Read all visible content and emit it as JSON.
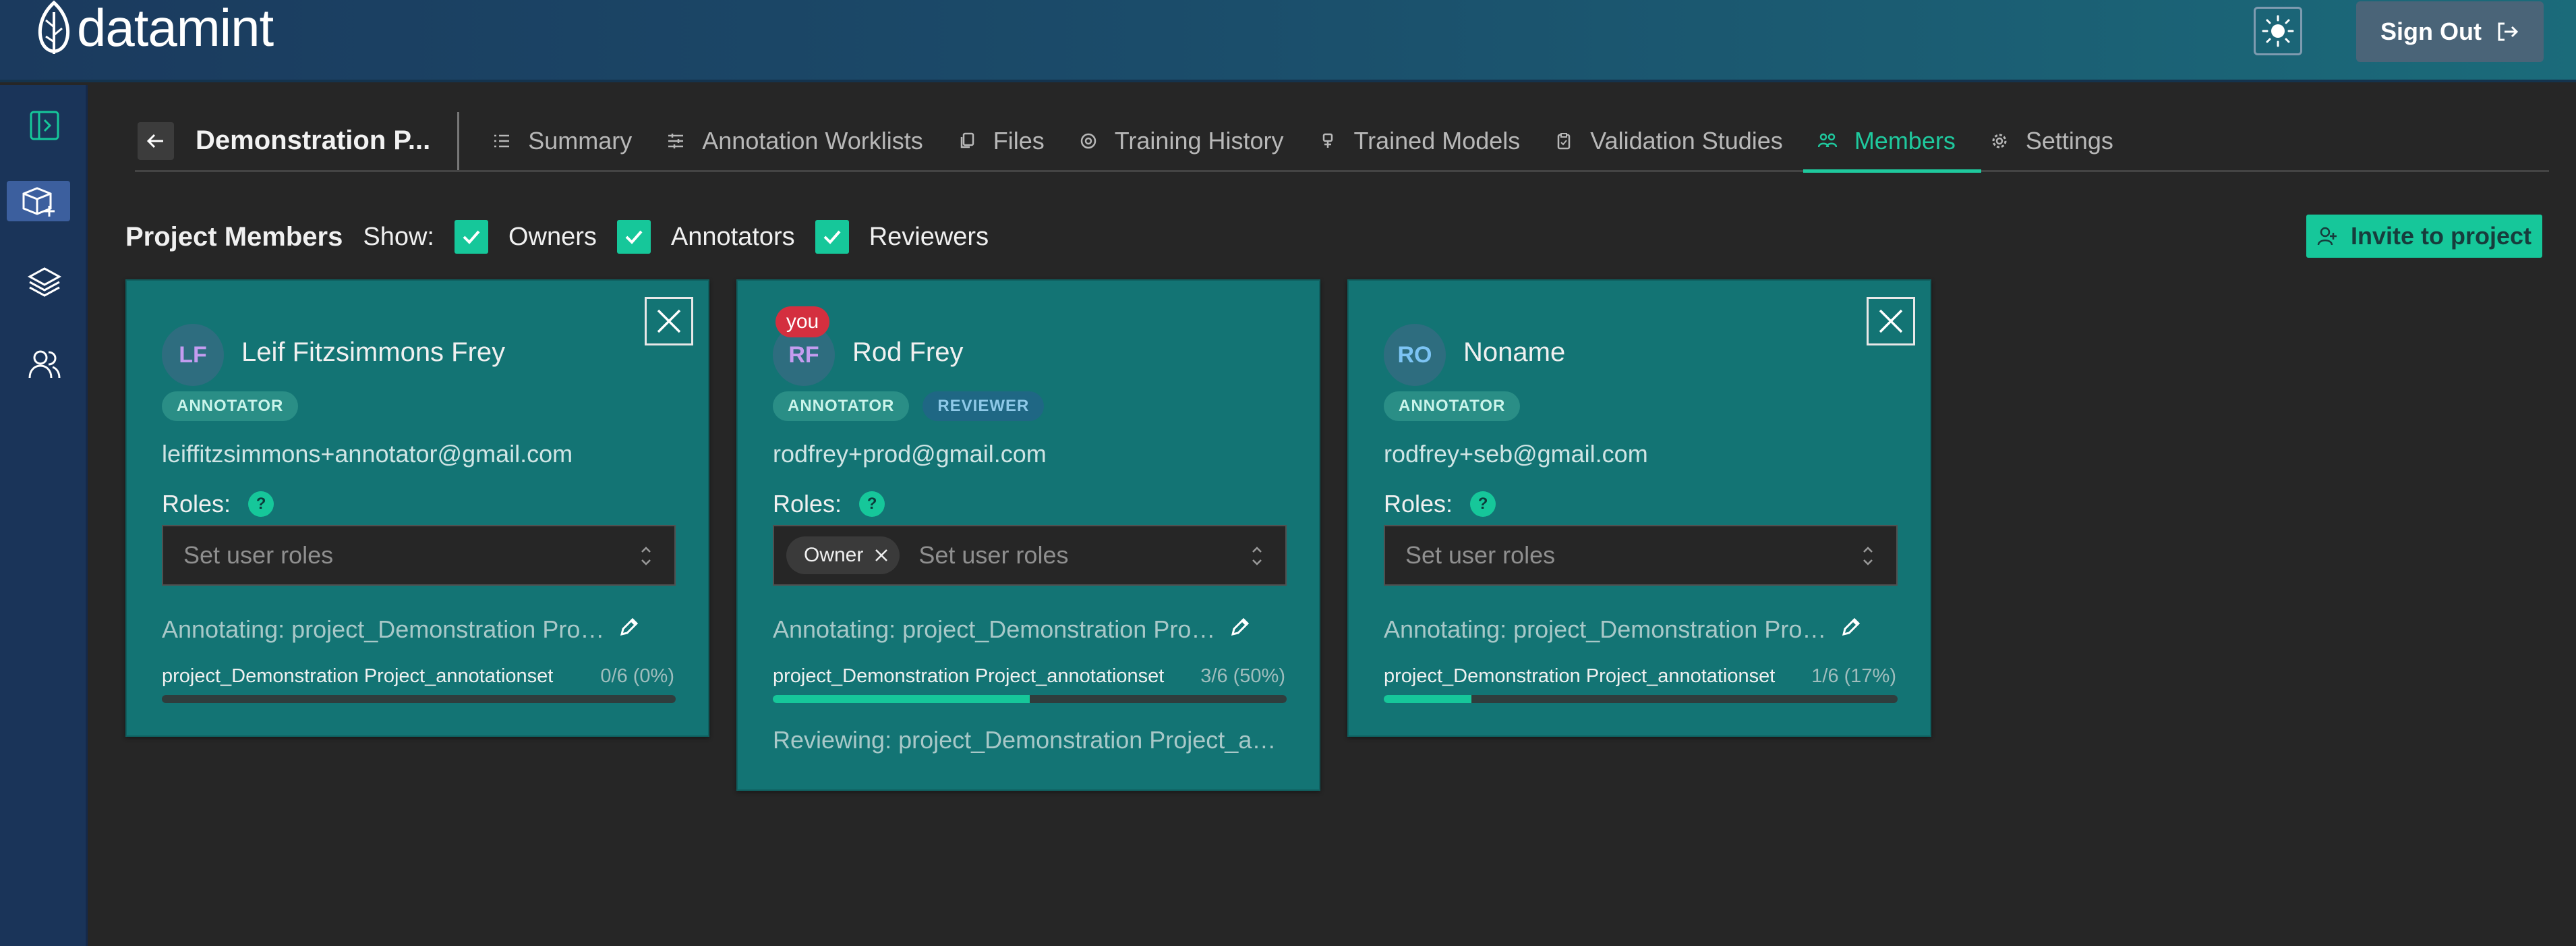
{
  "app": {
    "logo_text": "datamint",
    "sign_out_label": "Sign Out"
  },
  "project": {
    "title": "Demonstration P..."
  },
  "tabs": [
    {
      "label": "Summary",
      "icon": "list-icon"
    },
    {
      "label": "Annotation Worklists",
      "icon": "sliders-icon"
    },
    {
      "label": "Files",
      "icon": "files-icon"
    },
    {
      "label": "Training History",
      "icon": "history-icon"
    },
    {
      "label": "Trained Models",
      "icon": "robot-icon"
    },
    {
      "label": "Validation Studies",
      "icon": "clipboard-icon"
    },
    {
      "label": "Members",
      "icon": "users-icon",
      "active": true
    },
    {
      "label": "Settings",
      "icon": "gear-icon"
    }
  ],
  "members_header": {
    "title": "Project Members",
    "show_label": "Show:",
    "filters": [
      {
        "label": "Owners",
        "checked": true
      },
      {
        "label": "Annotators",
        "checked": true
      },
      {
        "label": "Reviewers",
        "checked": true
      }
    ],
    "invite_label": "Invite to project"
  },
  "members": [
    {
      "initials": "LF",
      "initials_color": "#c49cf0",
      "name": "Leif Fitzsimmons Frey",
      "badges": [
        "ANNOTATOR"
      ],
      "email": "leiffitzsimmons+annotator@gmail.com",
      "roles_label": "Roles:",
      "roles_help": "?",
      "roles_placeholder": "Set user roles",
      "annotating": "Annotating: project_Demonstration Proje...",
      "progress_set": "project_Demonstration Project_annotationset",
      "progress_text": "0/6 (0%)",
      "progress": 0
    },
    {
      "initials": "RF",
      "initials_color": "#c49cf0",
      "you_label": "you",
      "name": "Rod Frey",
      "badges": [
        "ANNOTATOR",
        "REVIEWER"
      ],
      "email": "rodfrey+prod@gmail.com",
      "roles_label": "Roles:",
      "roles_help": "?",
      "role_chip": "Owner",
      "roles_placeholder": "Set user roles",
      "annotating": "Annotating: project_Demonstration Proje...",
      "progress_set": "project_Demonstration Project_annotationset",
      "progress_text": "3/6 (50%)",
      "progress": 0.5,
      "reviewing": "Reviewing: project_Demonstration Project_anno..."
    },
    {
      "initials": "RO",
      "initials_color": "#7cc4f4",
      "name": "Noname",
      "badges": [
        "ANNOTATOR"
      ],
      "email": "rodfrey+seb@gmail.com",
      "roles_label": "Roles:",
      "roles_help": "?",
      "roles_placeholder": "Set user roles",
      "annotating": "Annotating: project_Demonstration Proje...",
      "progress_set": "project_Demonstration Project_annotationset",
      "progress_text": "1/6 (17%)",
      "progress": 0.17
    }
  ],
  "colors": {
    "accent": "#16c79a",
    "card": "#137474",
    "you_badge": "#d42f3f"
  }
}
